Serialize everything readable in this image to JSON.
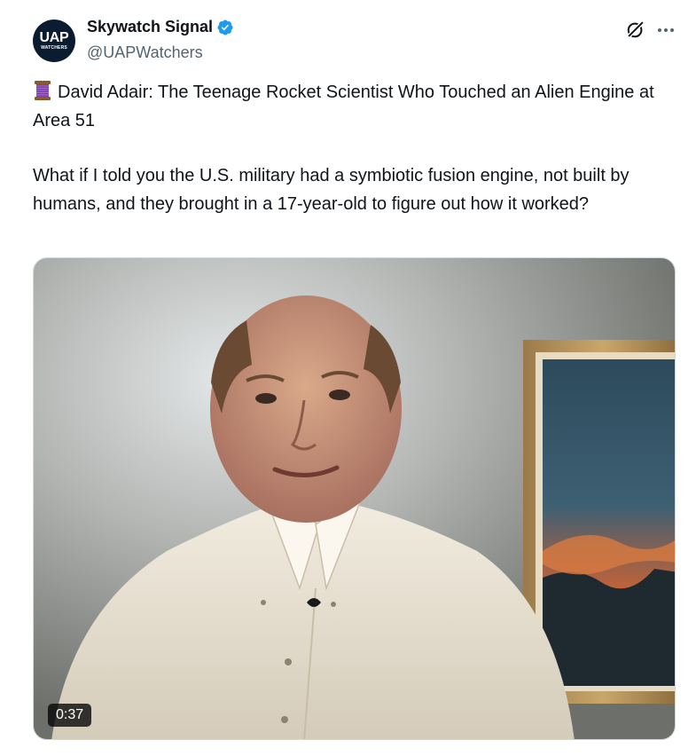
{
  "author": {
    "avatar_text": "UAP",
    "avatar_subtext": "WATCHERS",
    "display_name": "Skywatch Signal",
    "handle": "@UAPWatchers",
    "verified": true
  },
  "actions": {
    "grok_icon": "grok-icon",
    "more_icon": "more-icon"
  },
  "tweet": {
    "headline_emoji_icon": "thread-spool-icon",
    "headline": "David Adair: The Teenage Rocket Scientist Who Touched an Alien Engine at Area 51",
    "body": "What if I told you the U.S. military had a symbiotic fusion engine, not built by humans, and they brought in a 17-year-old to figure out how it worked?"
  },
  "media": {
    "type": "video",
    "duration": "0:37"
  },
  "colors": {
    "verified_blue": "#1d9bf0",
    "text_primary": "#0f1419",
    "text_secondary": "#536471",
    "avatar_bg": "#0c1c30"
  }
}
